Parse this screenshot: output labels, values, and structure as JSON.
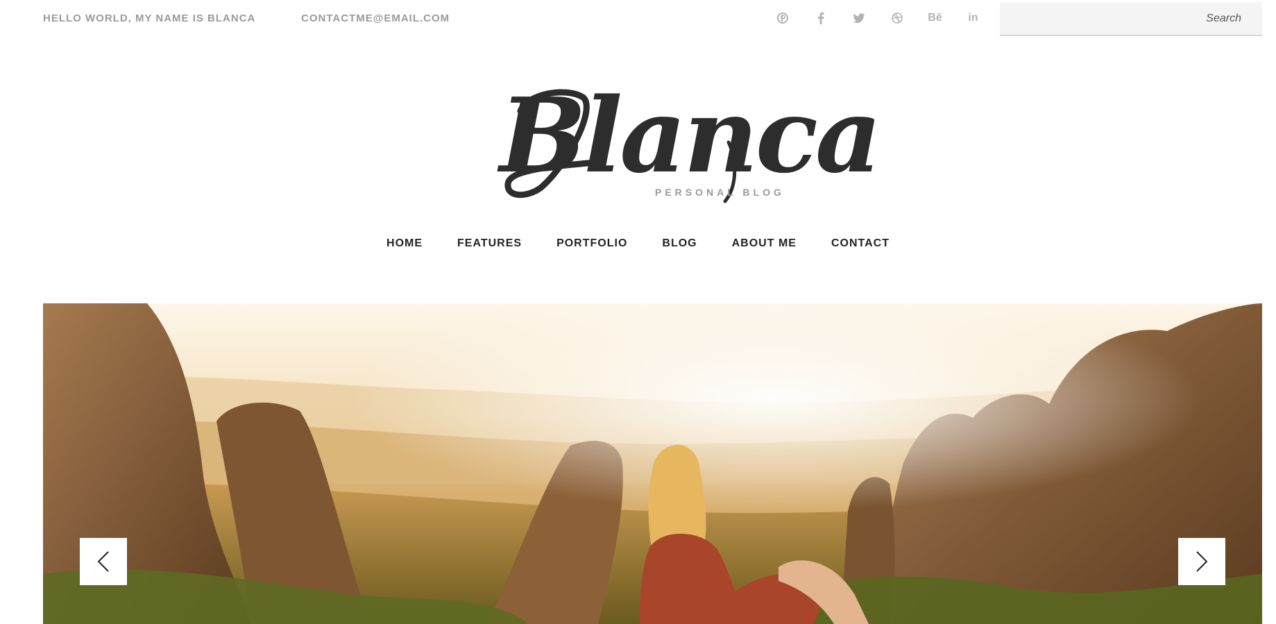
{
  "topbar": {
    "greeting": "HELLO WORLD, MY NAME IS BLANCA",
    "email": "CONTACTME@EMAIL.COM",
    "socials": [
      {
        "icon": "pinterest-icon"
      },
      {
        "icon": "facebook-icon"
      },
      {
        "icon": "twitter-icon"
      },
      {
        "icon": "dribbble-icon"
      },
      {
        "icon": "behance-icon",
        "label": "Bē"
      },
      {
        "icon": "linkedin-icon",
        "label": "in"
      }
    ],
    "search_placeholder": "Search"
  },
  "logo": {
    "wordmark": "Blanca",
    "tagline": "PERSONAL BLOG"
  },
  "nav": {
    "items": [
      "HOME",
      "FEATURES",
      "PORTFOLIO",
      "BLOG",
      "ABOUT ME",
      "CONTACT"
    ]
  },
  "hero": {
    "prev_icon": "chevron-left-icon",
    "next_icon": "chevron-right-icon"
  },
  "colors": {
    "text_muted": "#9a9a9a",
    "text_dark": "#222222",
    "search_bg": "#f4f4f4",
    "icon_gray": "#b3b3b3"
  }
}
